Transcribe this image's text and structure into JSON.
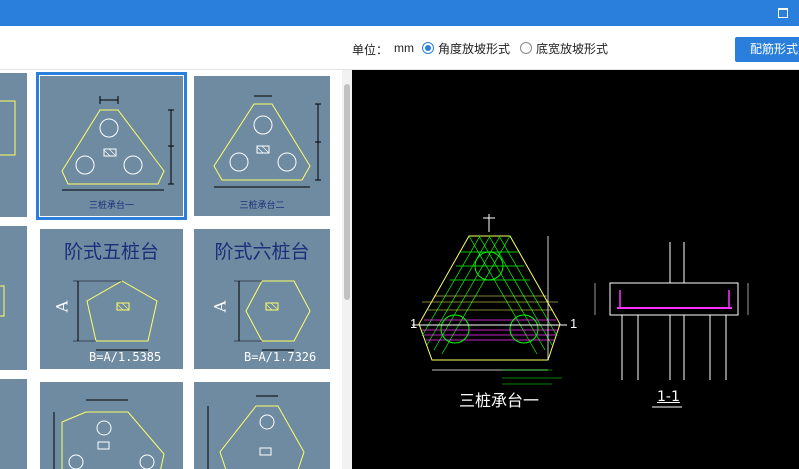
{
  "toolbar": {
    "unit_label": "单位：",
    "unit_value": "mm",
    "options": [
      {
        "label": "角度放坡形式",
        "selected": true
      },
      {
        "label": "底宽放坡形式",
        "selected": false
      }
    ],
    "config_button": "配筋形式"
  },
  "gallery": {
    "tiles": [
      {
        "caption": "三桩承台一",
        "selected": true
      },
      {
        "caption": "三桩承台二",
        "selected": false
      },
      {
        "title": "阶式五桩台",
        "dim_label": "A",
        "formula": "B=A/1.5385"
      },
      {
        "title": "阶式六桩台",
        "dim_label": "A",
        "formula": "B=A/1.7326"
      }
    ]
  },
  "preview": {
    "plan_title": "三桩承台一",
    "section_title": "1-1",
    "section_mark": "1"
  },
  "colors": {
    "accent": "#2a7fdc",
    "tile_bg": "#6f8ba2",
    "caption": "#1b2f7a",
    "drawing_line": "#ffff66"
  }
}
